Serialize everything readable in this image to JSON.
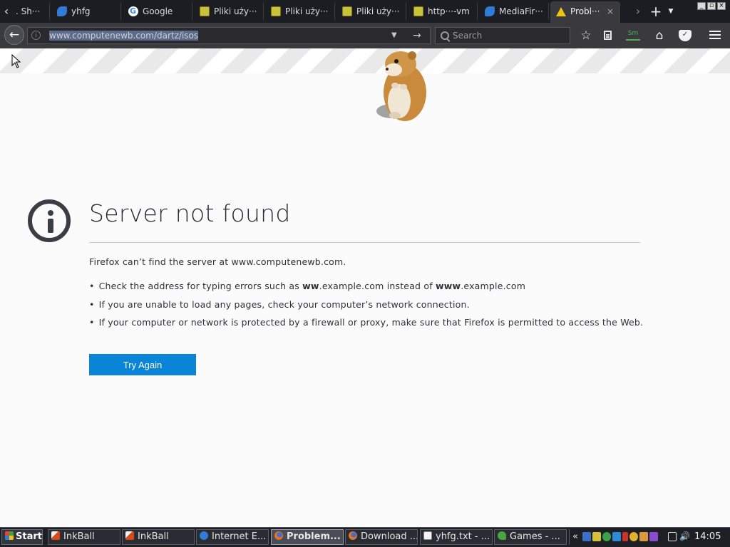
{
  "tabs": [
    {
      "label": ". Sh···",
      "icon": "none"
    },
    {
      "label": "yhfg",
      "icon": "blue-arrow-icon"
    },
    {
      "label": "Google",
      "icon": "google-icon"
    },
    {
      "label": "Pliki uży···",
      "icon": "pliki-icon"
    },
    {
      "label": "Pliki uży···",
      "icon": "pliki-icon"
    },
    {
      "label": "Pliki uży···",
      "icon": "pliki-icon"
    },
    {
      "label": "http···-vm",
      "icon": "pliki-icon"
    },
    {
      "label": "MediaFir···",
      "icon": "blue-arrow-icon"
    },
    {
      "label": "Probl···",
      "icon": "warning-icon",
      "active": true
    }
  ],
  "tab_close_glyph": "×",
  "navbar": {
    "url_host": "www.computenewb.com/dartz/",
    "url_selected_tail": "isos",
    "search_placeholder": "Search",
    "ext_label": "Sm"
  },
  "error_page": {
    "title": "Server not found",
    "description": "Firefox can’t find the server at www.computenewb.com.",
    "suggestions": [
      {
        "pre": "Check the address for typing errors such as ",
        "bold1": "ww",
        "mid": ".example.com instead of ",
        "bold2": "www",
        "post": ".example.com"
      },
      {
        "pre": "If you are unable to load any pages, check your computer’s network connection.",
        "bold1": "",
        "mid": "",
        "bold2": "",
        "post": ""
      },
      {
        "pre": "If your computer or network is protected by a firewall or proxy, make sure that Firefox is permitted to access the Web.",
        "bold1": "",
        "mid": "",
        "bold2": "",
        "post": ""
      }
    ],
    "bullet": "•",
    "try_again": "Try Again"
  },
  "taskbar": {
    "start": "Start",
    "tasks": [
      {
        "label": "InkBall",
        "icon": "inkball-icon"
      },
      {
        "label": "InkBall",
        "icon": "inkball-icon"
      },
      {
        "label": "Internet E...",
        "icon": "internet-explorer-icon"
      },
      {
        "label": "Problem...",
        "icon": "firefox-icon",
        "active": true
      },
      {
        "label": "Download ...",
        "icon": "firefox-icon"
      },
      {
        "label": "yhfg.txt - ...",
        "icon": "notepad-icon"
      },
      {
        "label": "Games - ...",
        "icon": "games-icon"
      }
    ],
    "tray_chevron": "«",
    "clock": "14:05"
  },
  "colors": {
    "accent": "#0a84d6",
    "tab_bg": "#1c1d22",
    "toolbar_bg": "#39393e",
    "page_bg": "#fbfbfc"
  }
}
